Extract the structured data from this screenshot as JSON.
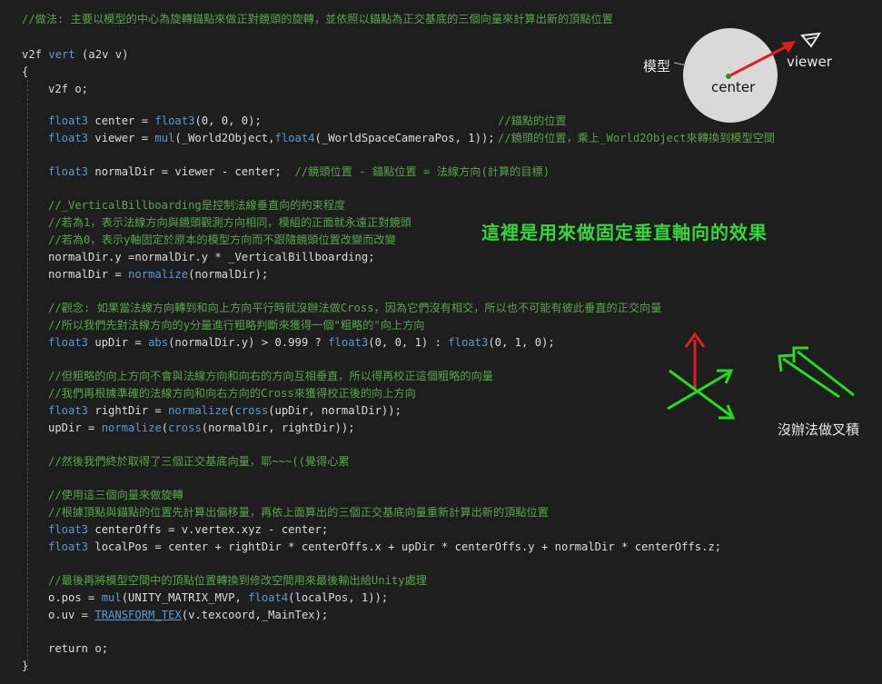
{
  "code": {
    "comment_intro": "//做法: 主要以模型的中心為旋轉錨點來做正對鏡頭的旋轉，並依照以錨點為正交基底的三個向量來計算出新的頂點位置",
    "sig_type": "v2f ",
    "sig_kw": "vert",
    "sig_rest": " (a2v v)",
    "open_brace": "{",
    "decl_o": "v2f o;",
    "center_type": "float3",
    "center_mid": " center = ",
    "center_ctor": "float3",
    "center_args": "(0, 0, 0);",
    "center_comment": "//錨點的位置",
    "viewer_type": "float3",
    "viewer_mid": " viewer = ",
    "viewer_mul": "mul",
    "viewer_args1": "(_World2Object,",
    "viewer_f4": "float4",
    "viewer_args2": "(_WorldSpaceCameraPos, 1));",
    "viewer_comment": "//鏡頭的位置，乘上_World2Object來轉換到模型空間",
    "normal_type": "float3",
    "normal_mid": " normalDir = viewer - center;  ",
    "normal_comment": "//鏡頭位置 - 錨點位置 = 法線方向(計算的目標)",
    "c_vb1": "//_VerticalBillboarding是控制法線垂直向的約束程度",
    "c_vb2": "//若為1，表示法線方向與鏡頭觀測方向相同，模組的正面就永遠正對鏡頭",
    "c_vb3": "//若為0，表示y軸固定於原本的模型方向而不跟隨鏡頭位置改變而改變",
    "normal_y": "normalDir.y =normalDir.y * _VerticalBillboarding;",
    "normalize_a": "normalDir = ",
    "normalize_kw": "normalize",
    "normalize_b": "(normalDir);",
    "c_concept1": "//觀念: 如果當法線方向轉到和向上方向平行時就沒辦法做Cross，因為它們沒有相交，所以也不可能有彼此垂直的正交向量",
    "c_concept2": "//所以我們先對法線方向的y分量進行粗略判斷來獲得一個\"粗略的\"向上方向",
    "up_type": "float3",
    "up_mid": " upDir = ",
    "up_abs": "abs",
    "up_cond": "(normalDir.y) > 0.999 ? ",
    "up_f3a": "float3",
    "up_a1": "(0, 0, 1) : ",
    "up_f3b": "float3",
    "up_a2": "(0, 1, 0);",
    "c_rough1": "//但粗略的向上方向不會與法線方向和向右的方向互相垂直，所以得再校正這個粗略的向量",
    "c_rough2": "//我們再根據準確的法線方向和向右方向的Cross來獲得校正後的向上方向",
    "right_type": "float3",
    "right_mid": " rightDir = ",
    "right_norm": "normalize",
    "right_p1": "(",
    "right_cross": "cross",
    "right_args": "(upDir, normalDir));",
    "up2_a": "upDir = ",
    "up2_norm": "normalize",
    "up2_p1": "(",
    "up2_cross": "cross",
    "up2_args": "(normalDir, rightDir));",
    "c_finally": "//然後我們終於取得了三個正交基底向量，耶~~~((覺得心累",
    "c_use1": "//使用這三個向量來做旋轉",
    "c_use2": "//根據頂點與錨點的位置先計算出偏移量，再依上面算出的三個正交基底向量重新計算出新的頂點位置",
    "offs_type": "float3",
    "offs_rest": " centerOffs = v.vertex.xyz - center;",
    "local_type": "float3",
    "local_rest": " localPos = center + rightDir * centerOffs.x + upDir * centerOffs.y + normalDir * centerOffs.z;",
    "c_last": "//最後再將模型空間中的頂點位置轉換到修改空間用來最後輸出給Unity處理",
    "pos_a": "o.pos = ",
    "pos_mul": "mul",
    "pos_b": "(UNITY_MATRIX_MVP, ",
    "pos_f4": "float4",
    "pos_c": "(localPos, 1));",
    "uv_a": "o.uv = ",
    "uv_macro": "TRANSFORM_TEX",
    "uv_b": "(v.texcoord,_MainTex);",
    "ret": "return o;",
    "close_brace": "}"
  },
  "annotations": {
    "model_label": "模型",
    "center_label": "center",
    "viewer_label": "viewer",
    "vertical_effect": "這裡是用來做固定垂直軸向的效果",
    "no_cross": "沒辦法做叉積"
  },
  "colors": {
    "background": "#1e1e1e",
    "code": "#dcdcdc",
    "comment": "#57a64a",
    "keyword": "#569cd6",
    "annotation_green": "#35d83a",
    "arrow_red": "#e02020",
    "arrow_green": "#22dd22",
    "model_circle": "#d9d9d9"
  }
}
